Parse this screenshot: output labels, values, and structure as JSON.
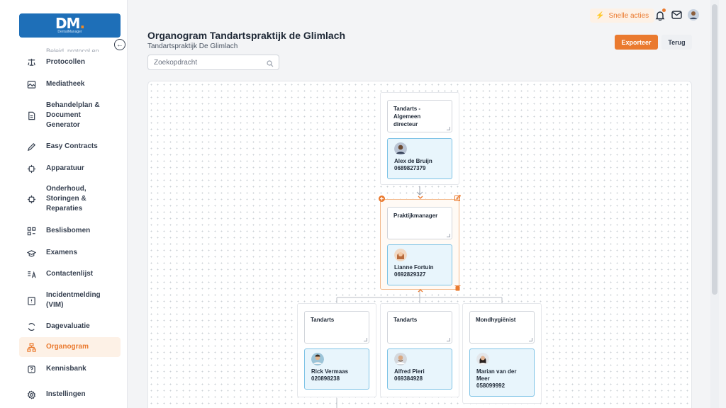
{
  "sidebar": {
    "logo_mark": "DM",
    "logo_dot": ".",
    "logo_sub": "DentalManager",
    "cut_text": "Beleid, protocol en",
    "items": [
      {
        "label": "Protocollen",
        "icon": "protocol-icon"
      },
      {
        "label": "Mediatheek",
        "icon": "image-icon"
      },
      {
        "label": "Behandelplan & Document Generator",
        "icon": "document-icon"
      },
      {
        "label": "Easy Contracts",
        "icon": "pen-icon"
      },
      {
        "label": "Apparatuur",
        "icon": "chip-icon"
      },
      {
        "label": "Onderhoud, Storingen & Reparaties",
        "icon": "chip-icon"
      },
      {
        "label": "Beslisbomen",
        "icon": "decision-tree-icon"
      },
      {
        "label": "Examens",
        "icon": "graduation-cap-icon"
      },
      {
        "label": "Contactenlijst",
        "icon": "contacts-icon"
      },
      {
        "label": "Incidentmelding (VIM)",
        "icon": "alert-icon"
      },
      {
        "label": "Dagevaluatie",
        "icon": "refresh-icon"
      },
      {
        "label": "Organogram",
        "icon": "org-chart-icon"
      },
      {
        "label": "Kennisbank",
        "icon": "help-icon"
      },
      {
        "label": "Instellingen",
        "icon": "gear-icon"
      }
    ]
  },
  "topbar": {
    "quick_actions": "Snelle acties"
  },
  "header": {
    "title": "Organogram Tandartspraktijk de Glimlach",
    "subtitle": "Tandartspraktijk De Glimlach",
    "search_placeholder": "Zoekopdracht",
    "export_label": "Exporteer",
    "back_label": "Terug"
  },
  "org": {
    "director": {
      "role": "Tandarts - Algemeen directeur",
      "name": "Alex de Bruijn",
      "phone": "0689827379"
    },
    "manager": {
      "role": "Praktijkmanager",
      "name": "Lianne Fortuin",
      "phone": "0692829327"
    },
    "dentist1": {
      "role": "Tandarts",
      "name": "Rick Vermaas",
      "phone": "020898238"
    },
    "dentist2": {
      "role": "Tandarts",
      "name": "Alfred Pieri",
      "phone": "069384928"
    },
    "hygienist": {
      "role": "Mondhygiënist",
      "name": "Marian van der Meer",
      "phone": "058099992"
    }
  },
  "colors": {
    "accent": "#ea7a2f",
    "brand": "#1e6fb8",
    "person_card": "#e8f5fc"
  }
}
